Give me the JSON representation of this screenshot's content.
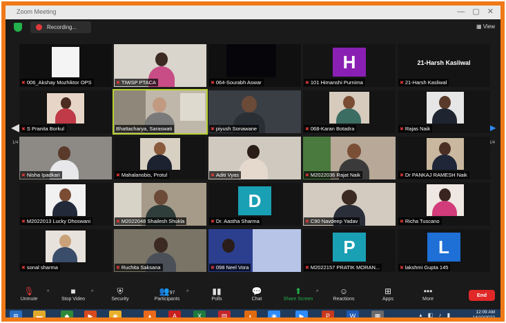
{
  "window": {
    "title": "Zoom Meeting"
  },
  "top": {
    "recording_label": "Recording...",
    "view_label": "View"
  },
  "pager": {
    "left_page": "1/4",
    "right_page": "1/4"
  },
  "participants": [
    "006_Akshay Mozhiktor OPS",
    "TIWSP PTACA",
    "064-Sourabh Aswar",
    "101 Himanshi Purnima",
    "21-Harsh Kasliwal",
    "S Pranita Borkul",
    "Bhattacharya, Saraswati",
    "piyush Sonawane",
    "068-Karan Botadra",
    "Rajas Naik",
    "Nisha Ipadkari",
    "Mahalanobis, Protul",
    "Aditi Vyas",
    "M2022036 Rajat Naik",
    "Dr PANKAJ RAMESH Naik",
    "M2022013 Lucky Dhoswani",
    "M2022048 Shailesh Shukla",
    "Dr. Aastha Sharma",
    "C90 Navdeep Yadav",
    "Richa Tuscano",
    "sonal sharma",
    "Ruchita Saksana",
    "098 Neel Vora",
    "M2022157 PRATIK MORAN...",
    "lakshmi Gupta 145"
  ],
  "avatars": {
    "t4": "H",
    "t18": "D",
    "t24": "P",
    "t25": "L",
    "t5": "21-Harsh Kasliwal"
  },
  "colors": {
    "accent_border": "#f07a18",
    "h_avatar": "#8a1fb4",
    "d_avatar": "#1aa0b4",
    "p_avatar": "#1aa0b4",
    "l_avatar": "#1e6fd6",
    "end": "#e02828",
    "active_speaker": "#b8d230"
  },
  "toolbar": {
    "unmute": "Unmute",
    "stop_video": "Stop Video",
    "security": "Security",
    "participants": "Participants",
    "participants_count": "97",
    "polls": "Polls",
    "chat": "Chat",
    "share_screen": "Share Screen",
    "reactions": "Reactions",
    "apps": "Apps",
    "more": "More",
    "end": "End"
  },
  "taskbar": {
    "time": "12:09 AM",
    "date": "14/10/2022"
  }
}
